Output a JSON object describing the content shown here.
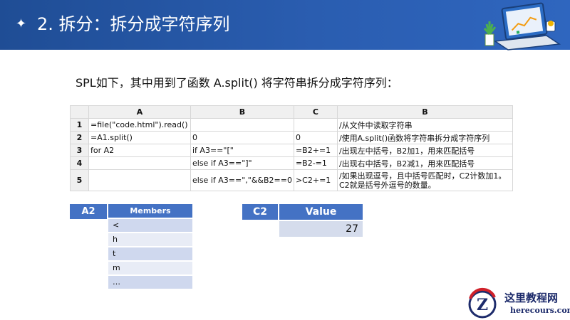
{
  "header": {
    "title": "2. 拆分：拆分成字符序列"
  },
  "intro": "SPL如下，其中用到了函数 A.split() 将字符串拆分成字符序列：",
  "grid": {
    "columns": [
      "A",
      "B",
      "C",
      "B"
    ],
    "rows": [
      {
        "n": "1",
        "a": "=file(\"code.html\").read()",
        "b": "",
        "c": "",
        "d": "/从文件中读取字符串"
      },
      {
        "n": "2",
        "a": "=A1.split()",
        "b": "0",
        "c": "0",
        "d": "/使用A.split()函数将字符串拆分成字符序列"
      },
      {
        "n": "3",
        "a": "for A2",
        "b": "if A3==\"[\"",
        "c": "=B2+=1",
        "d": "/出现左中括号，B2加1，用来匹配括号"
      },
      {
        "n": "4",
        "a": "",
        "b": "else if A3==\"]\"",
        "c": "=B2-=1",
        "d": "/出现右中括号，B2减1，用来匹配括号"
      },
      {
        "n": "5",
        "a": "",
        "b": "else if A3==\",\"&&B2==0",
        "c": ">C2+=1",
        "d": "/如果出现逗号，且中括号匹配时，C2计数加1。C2就是括号外逗号的数量。"
      }
    ]
  },
  "a2": {
    "label": "A2",
    "header": "Members",
    "items": [
      "<",
      "h",
      "t",
      "m",
      "…"
    ]
  },
  "c2": {
    "label": "C2",
    "header": "Value",
    "value": "27"
  },
  "watermark": {
    "cn": "这里教程网",
    "en": "herecours.com"
  },
  "colors": {
    "banner": "#2a5db0",
    "label_blue": "#4472c4",
    "cell_blue": "#d5dcec"
  }
}
